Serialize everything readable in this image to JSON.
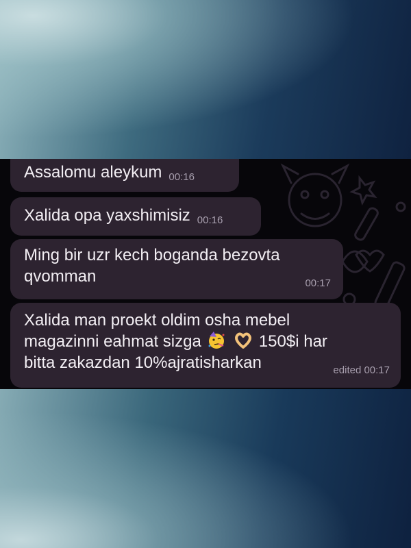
{
  "messages": [
    {
      "text": "Assalomu aleykum",
      "time": "00:16"
    },
    {
      "text": "Xalida opa yaxshimisiz",
      "time": "00:16"
    },
    {
      "line1": "Ming bir uzr kech boganda bezovta",
      "line2": "qvomman",
      "time": "00:17"
    },
    {
      "line1": "Xalida man proekt oldim osha mebel",
      "line2a": "magazinni eahmat sizga",
      "emoji1": "partying-face-emoji",
      "emoji2": "heart-hands-emoji",
      "line2b": "150$i har",
      "line3": "bitta zakazdan 10%ajratisharkan",
      "time": "edited 00:17"
    }
  ],
  "colors": {
    "bubble": "#2d2330",
    "chat_bg": "#07060a",
    "text": "#f2eef3",
    "time": "#a89fae"
  }
}
